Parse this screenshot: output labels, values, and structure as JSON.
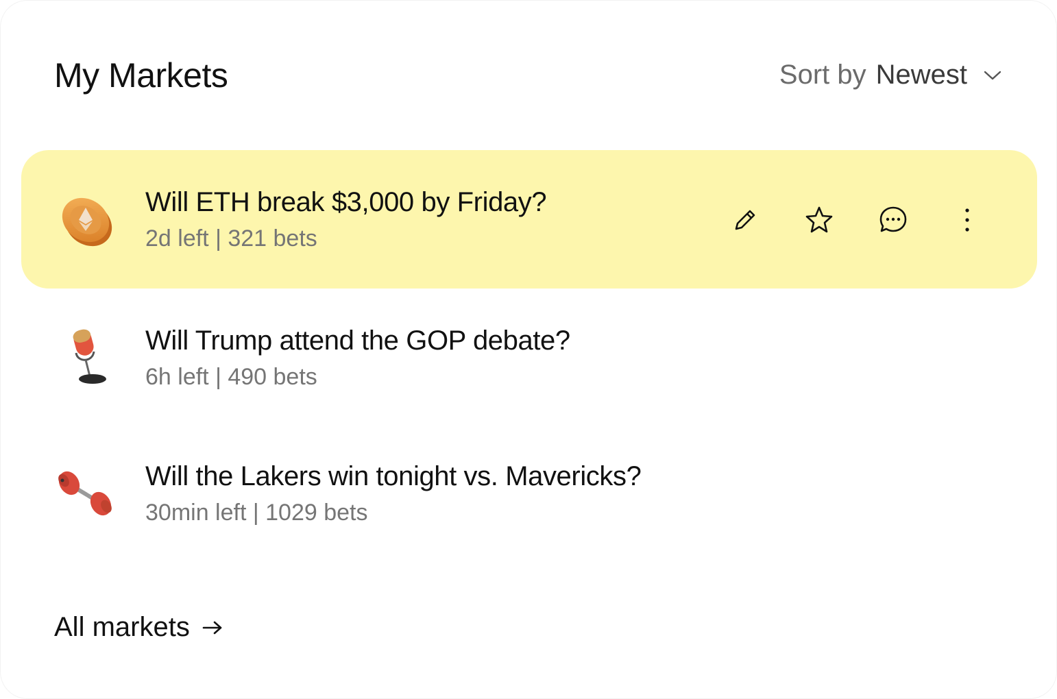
{
  "header": {
    "title": "My Markets",
    "sort_prefix": "Sort by",
    "sort_value": "Newest"
  },
  "markets": [
    {
      "question": "Will ETH break $3,000 by Friday?",
      "meta": "2d left | 321 bets",
      "icon": "eth-coin-icon",
      "highlighted": true
    },
    {
      "question": "Will Trump attend the GOP debate?",
      "meta": "6h left | 490 bets",
      "icon": "microphone-icon",
      "highlighted": false
    },
    {
      "question": "Will the Lakers win tonight vs. Mavericks?",
      "meta": "30min left | 1029 bets",
      "icon": "dumbbell-icon",
      "highlighted": false
    }
  ],
  "actions": [
    "edit-icon",
    "star-icon",
    "comment-icon",
    "more-icon"
  ],
  "footer": {
    "all_markets_label": "All markets"
  },
  "colors": {
    "highlight": "#fdf6ad",
    "muted_text": "#757575",
    "primary_text": "#111111"
  }
}
